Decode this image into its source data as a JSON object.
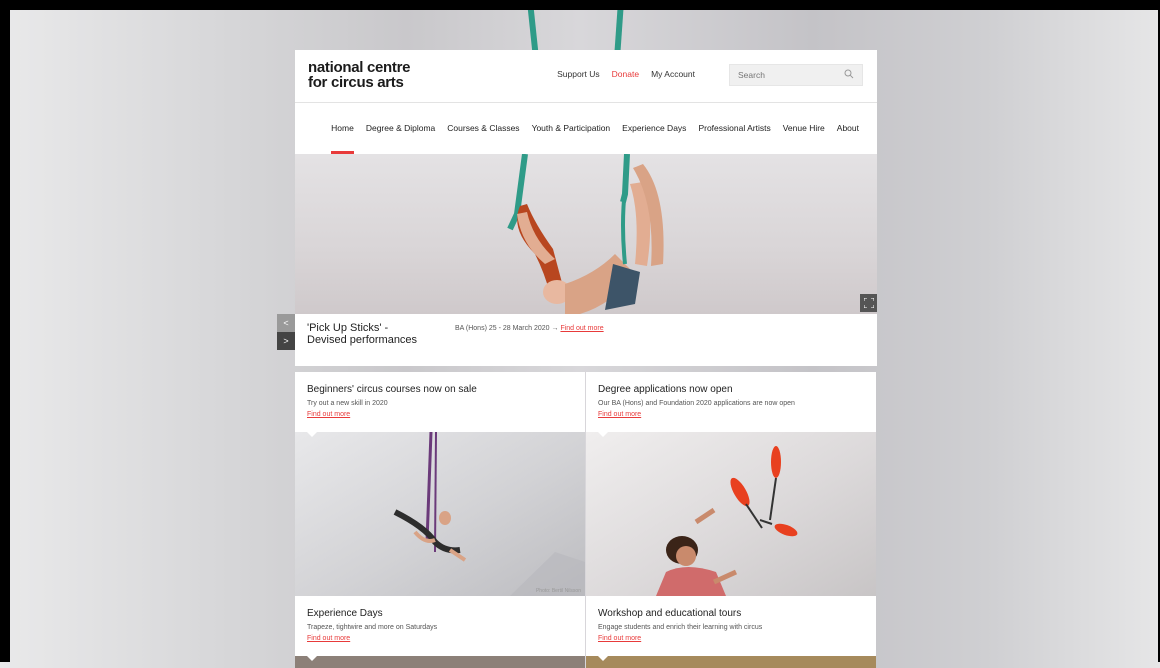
{
  "header": {
    "logo_line1": "national centre",
    "logo_line2": "for circus arts",
    "links": {
      "support": "Support Us",
      "donate": "Donate",
      "account": "My Account"
    },
    "search_placeholder": "Search"
  },
  "nav": {
    "items": [
      "Home",
      "Degree & Diploma",
      "Courses & Classes",
      "Youth & Participation",
      "Experience Days",
      "Professional Artists",
      "Venue Hire",
      "About"
    ],
    "active": "Home"
  },
  "slide": {
    "title": "'Pick Up Sticks' - Devised performances",
    "meta": "BA (Hons) 25 - 28 March 2020 → ",
    "link": "Find out more",
    "prev": "<",
    "next": ">"
  },
  "cards": [
    {
      "title": "Beginners' circus courses now on sale",
      "subtitle": "Try out a new skill in 2020",
      "link": "Find out more"
    },
    {
      "title": "Degree applications now open",
      "subtitle": "Our BA (Hons) and Foundation 2020 applications are now open",
      "link": "Find out more"
    },
    {
      "title": "Experience Days",
      "subtitle": "Trapeze, tightwire and more on Saturdays",
      "link": "Find out more"
    },
    {
      "title": "Workshop and educational tours",
      "subtitle": "Engage students and enrich their learning with circus",
      "link": "Find out more"
    }
  ],
  "photo_credit": "Photo: Bertil Nilsson",
  "colors": {
    "accent": "#e83a3a",
    "silk": "#2f9b88"
  }
}
